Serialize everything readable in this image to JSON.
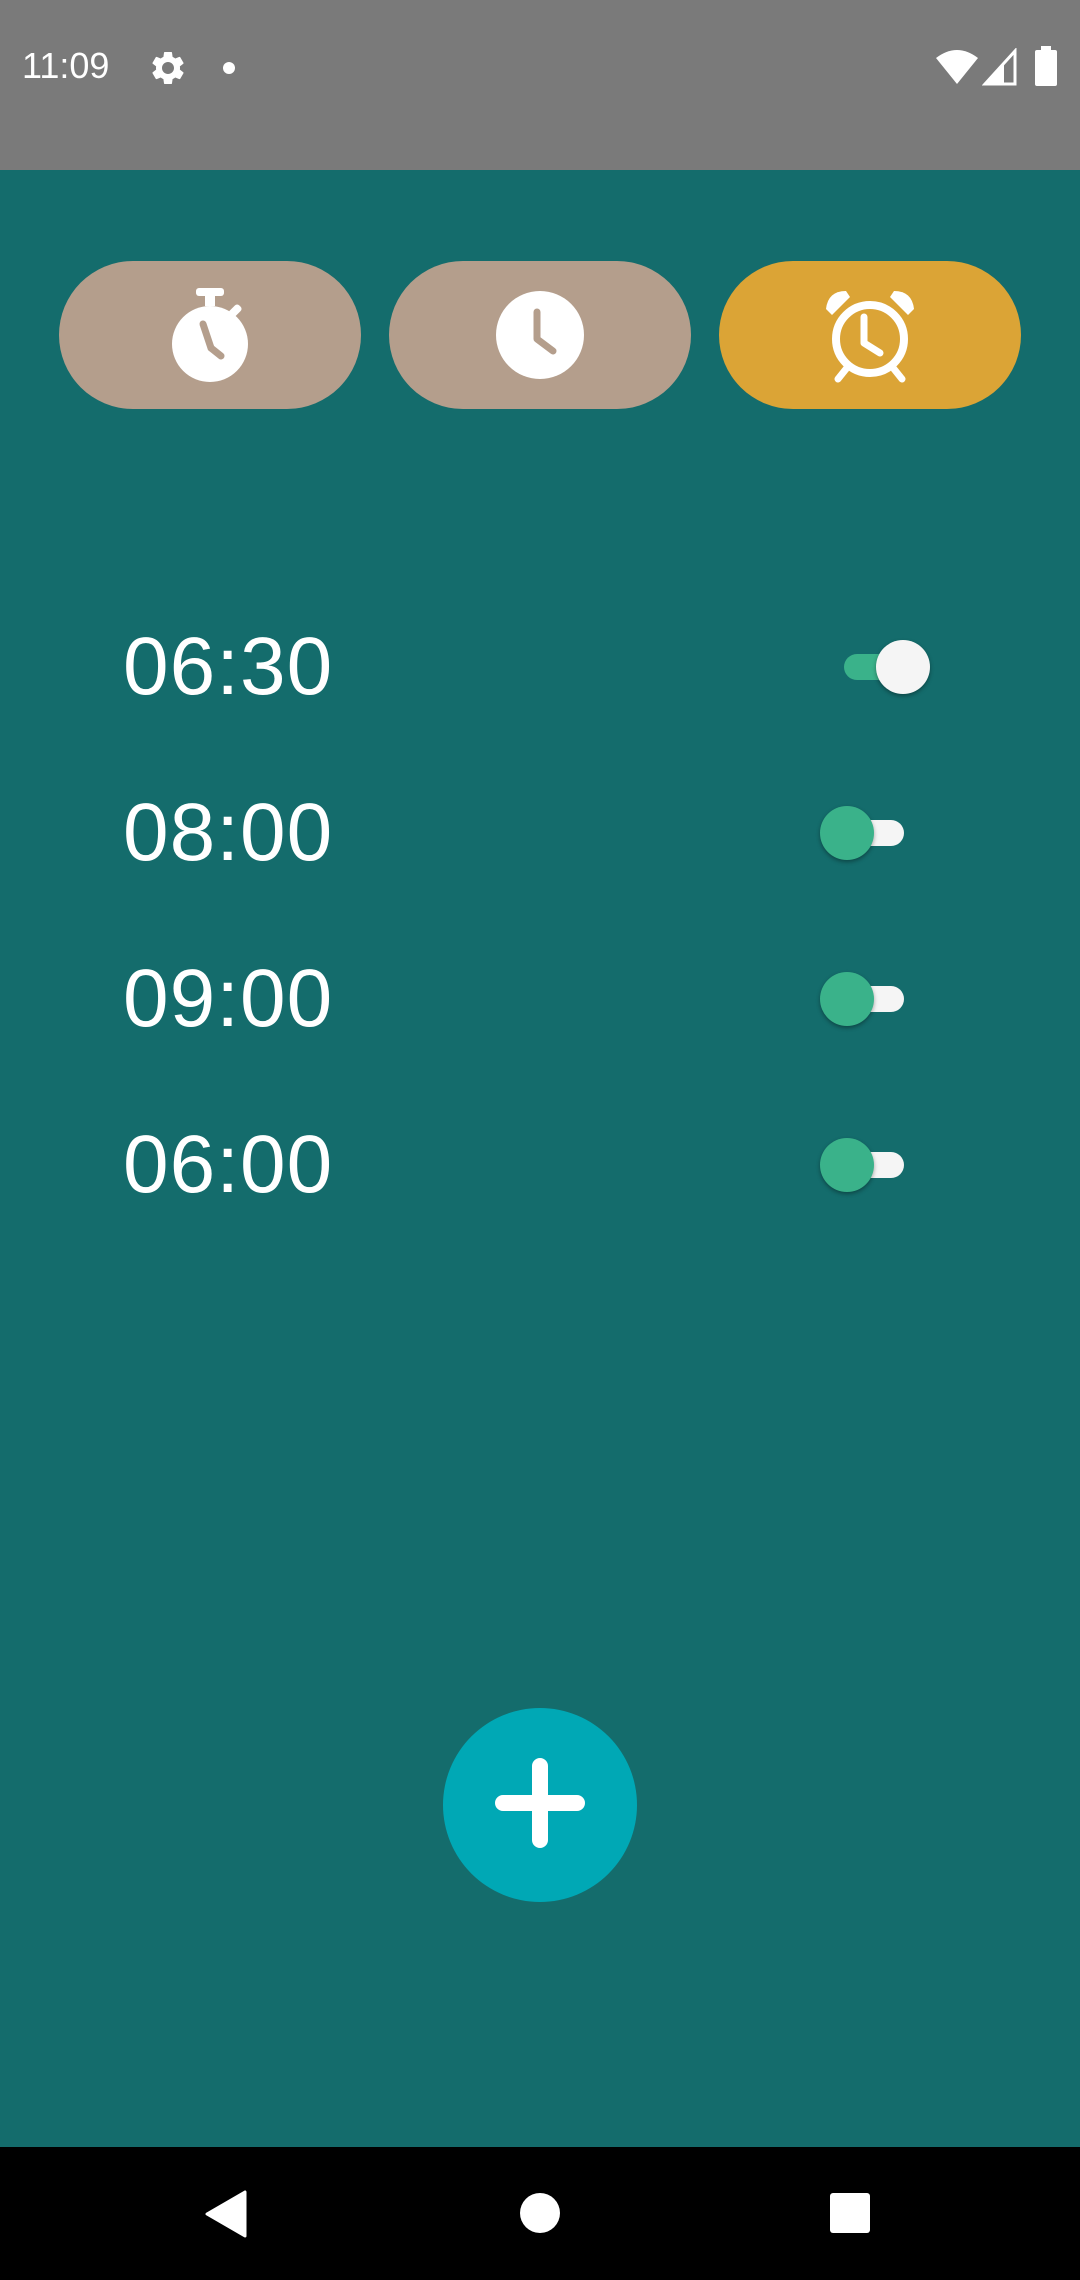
{
  "status_bar": {
    "time": "11:09",
    "icons": [
      "gear-icon",
      "notification-dot-icon",
      "wifi-icon",
      "signal-icon",
      "battery-icon"
    ]
  },
  "mode_tabs": [
    {
      "name": "stopwatch",
      "icon": "stopwatch-icon",
      "active": false
    },
    {
      "name": "clock",
      "icon": "clock-icon",
      "active": false
    },
    {
      "name": "alarm",
      "icon": "alarm-clock-icon",
      "active": true
    }
  ],
  "alarms": [
    {
      "time": "06:30",
      "enabled": true
    },
    {
      "time": "08:00",
      "enabled": false
    },
    {
      "time": "09:00",
      "enabled": false
    },
    {
      "time": "06:00",
      "enabled": false
    }
  ],
  "fab": {
    "icon": "plus-icon"
  },
  "nav_bar": {
    "icons": [
      "back-icon",
      "home-icon",
      "recents-icon"
    ]
  },
  "colors": {
    "status_bar": "#7a7a7a",
    "background": "#146c6c",
    "tab_inactive": "#b49e8c",
    "tab_active": "#dba436",
    "switch_green": "#3ab28a",
    "switch_white": "#f5f5f5",
    "fab": "#00a8b5",
    "nav_bar": "#000000"
  }
}
